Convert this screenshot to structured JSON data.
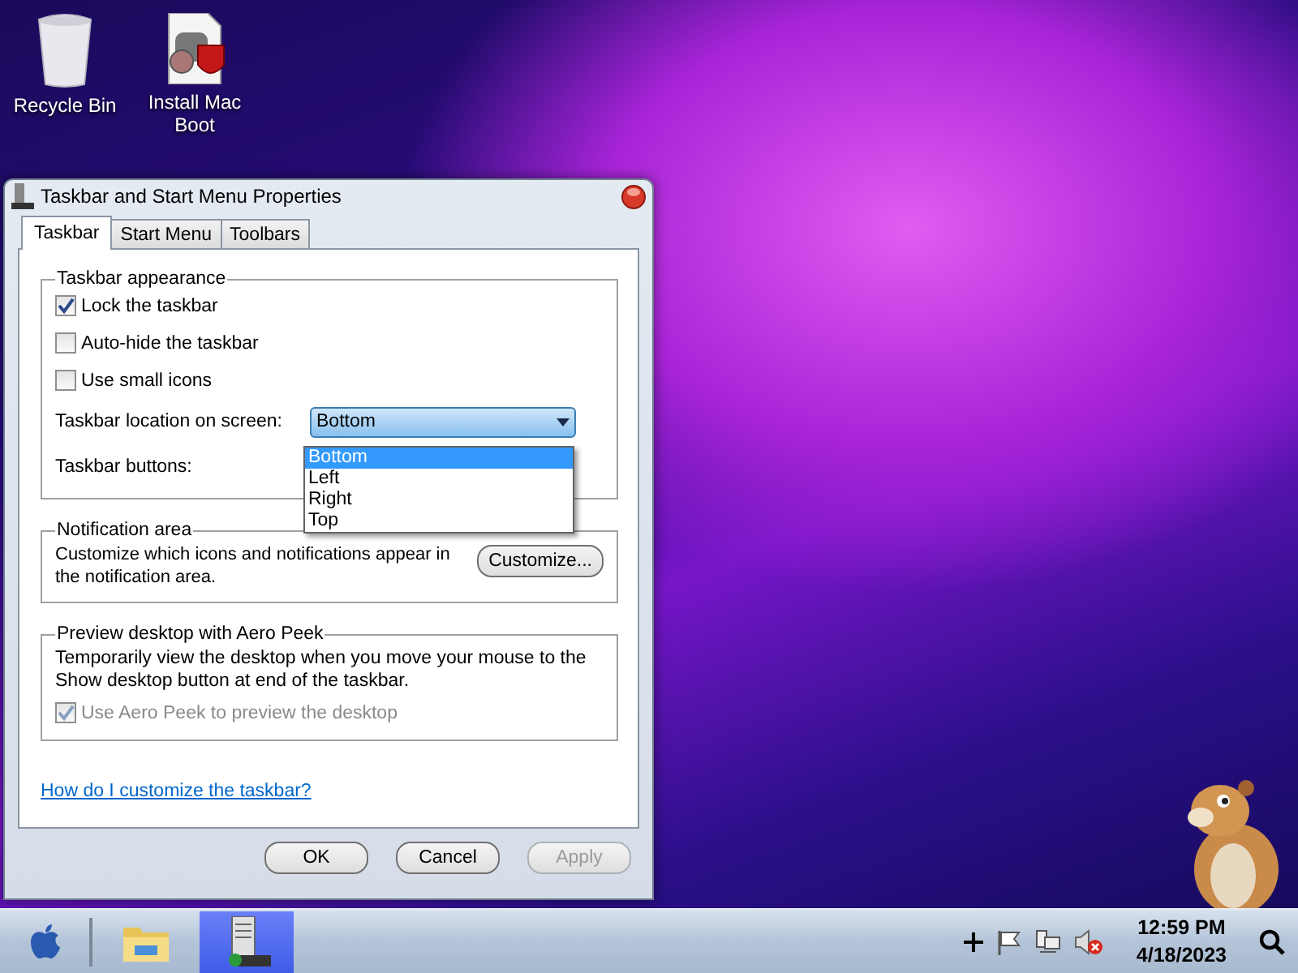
{
  "desktop_icons": [
    {
      "kind": "bin",
      "label": "Recycle Bin"
    },
    {
      "kind": "installer",
      "label": "Install Mac Boot"
    }
  ],
  "dialog": {
    "title": "Taskbar and Start Menu Properties",
    "tabs": [
      {
        "label": "Taskbar",
        "selected": true
      },
      {
        "label": "Start Menu",
        "selected": false
      },
      {
        "label": "Toolbars",
        "selected": false
      }
    ],
    "appearance": {
      "legend": "Taskbar appearance",
      "checkboxes": [
        {
          "label": "Lock the taskbar",
          "checked": true
        },
        {
          "label": "Auto-hide the taskbar",
          "checked": false
        },
        {
          "label": "Use small icons",
          "checked": false
        }
      ],
      "location_label": "Taskbar location on screen:",
      "location_value": "Bottom",
      "location_options": [
        {
          "label": "Bottom",
          "selected": true
        },
        {
          "label": "Left",
          "selected": false
        },
        {
          "label": "Right",
          "selected": false
        },
        {
          "label": "Top",
          "selected": false
        }
      ],
      "buttons_label": "Taskbar buttons:"
    },
    "notification": {
      "legend": "Notification area",
      "text": "Customize which icons and notifications appear in the notification area.",
      "button": "Customize..."
    },
    "peek": {
      "legend": "Preview desktop with Aero Peek",
      "text": "Temporarily view the desktop when you move your mouse to the Show desktop button at end of the taskbar.",
      "checkbox": {
        "label": "Use Aero Peek to preview the desktop",
        "checked": true,
        "disabled": true
      }
    },
    "help_link": "How do I customize the taskbar?",
    "buttons": [
      {
        "label": "OK",
        "disabled": false
      },
      {
        "label": "Cancel",
        "disabled": false
      },
      {
        "label": "Apply",
        "disabled": true
      }
    ]
  },
  "taskbar": {
    "apps": [
      {
        "kind": "folder",
        "selected": false
      },
      {
        "kind": "server",
        "selected": true
      }
    ],
    "clock": {
      "time": "12:59 PM",
      "date": "4/18/2023"
    }
  }
}
